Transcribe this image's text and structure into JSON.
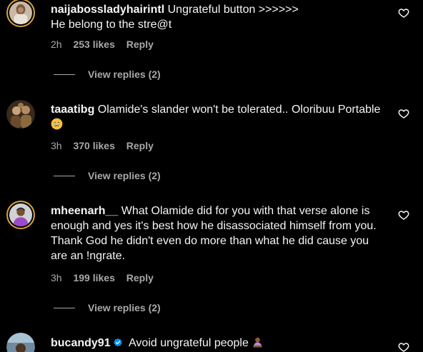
{
  "comments": [
    {
      "username": "naijabossladyhairintl",
      "text": "Ungrateful button >>>>>>",
      "text_line2": "He belong to the stre@t",
      "time": "2h",
      "likes": "253 likes",
      "reply": "Reply",
      "view_replies": "View replies (2)",
      "avatar": "avatar-woman-photo",
      "has_story_ring": true
    },
    {
      "username": "taaatibg",
      "text": "Olamide's slander won't be tolerated.. Oloribuu Portable",
      "emoji": "crying-face-emoji",
      "time": "3h",
      "likes": "370 likes",
      "reply": "Reply",
      "view_replies": "View replies (2)",
      "avatar": "avatar-painting",
      "has_story_ring": false
    },
    {
      "username": "mheenarh__",
      "text": "What Olamide did for you with that verse alone is enough and yes it's best how he disassociated himself from you. Thank God he didn't even do more than what he did cause you are an !ngrate.",
      "time": "3h",
      "likes": "199 likes",
      "reply": "Reply",
      "view_replies": "View replies (2)",
      "avatar": "avatar-woman-purple",
      "has_story_ring": true
    },
    {
      "username": "bucandy91",
      "verified": true,
      "text": "Avoid ungrateful people",
      "emoji": "person-bowing-emoji",
      "avatar": "avatar-outdoor",
      "has_story_ring": false
    }
  ],
  "icons": {
    "like": "heart-outline-icon",
    "verified": "verified-badge-icon"
  },
  "colors": {
    "background": "#000000",
    "text": "#f5f5f5",
    "secondary": "#a8a8a8",
    "verified": "#0095f6",
    "story_ring": "#d8a23b"
  }
}
